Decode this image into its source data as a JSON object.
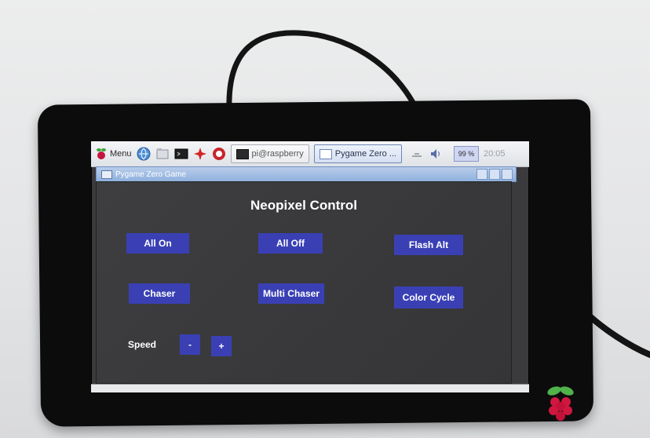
{
  "taskbar": {
    "menu_label": "Menu",
    "tasks": [
      {
        "label": "pi@raspberry"
      },
      {
        "label": "Pygame Zero ..."
      }
    ],
    "cpu": "99 %",
    "clock": "20:05"
  },
  "window": {
    "title": "Pygame Zero Game"
  },
  "app": {
    "heading": "Neopixel Control",
    "buttons": {
      "all_on": "All On",
      "all_off": "All Off",
      "flash_alt": "Flash Alt",
      "chaser": "Chaser",
      "multi_chaser": "Multi Chaser",
      "color_cycle": "Color Cycle",
      "speed_minus": "-",
      "speed_plus": "+"
    },
    "speed_label": "Speed"
  },
  "colors": {
    "button_bg": "#3a40b4",
    "canvas_bg": "#3b3b3e",
    "title_bar": "#8fb0dd",
    "bezel": "#0c0c0d"
  }
}
